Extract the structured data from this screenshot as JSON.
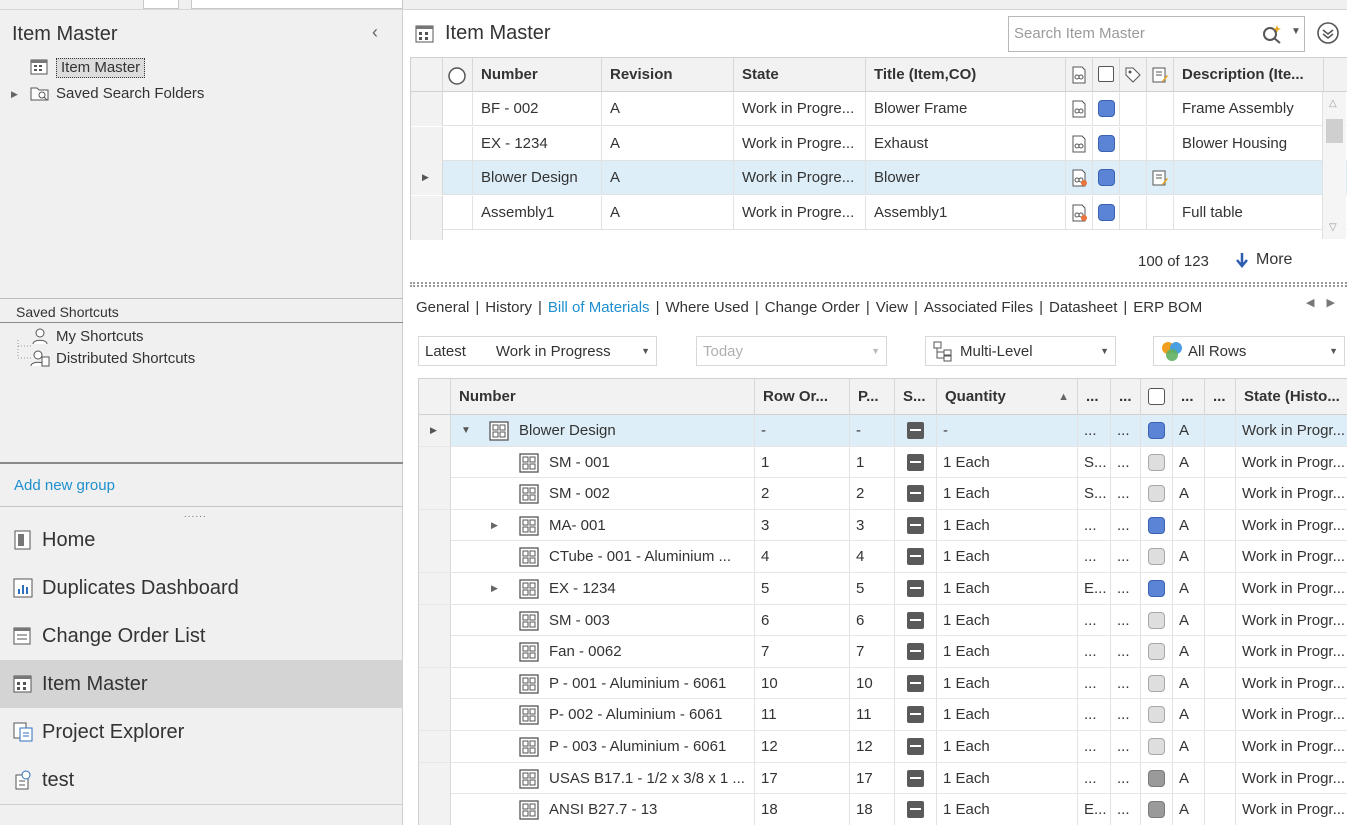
{
  "left": {
    "title": "Item Master",
    "tree": [
      {
        "label": "Item Master",
        "icon": "item-master-icon"
      },
      {
        "label": "Saved Search Folders",
        "icon": "saved-search-folder-icon"
      }
    ],
    "shortcuts_header": "Saved Shortcuts",
    "shortcuts": [
      {
        "label": "My Shortcuts",
        "icon": "user-icon"
      },
      {
        "label": "Distributed Shortcuts",
        "icon": "distributed-user-icon"
      }
    ],
    "add_group": "Add new group",
    "grip": "......",
    "nav": [
      {
        "label": "Home",
        "icon": "home-icon",
        "active": false
      },
      {
        "label": "Duplicates Dashboard",
        "icon": "dashboard-icon",
        "active": false
      },
      {
        "label": "Change Order List",
        "icon": "change-order-list-icon",
        "active": false
      },
      {
        "label": "Item Master",
        "icon": "item-master-icon",
        "active": true
      },
      {
        "label": "Project Explorer",
        "icon": "project-explorer-icon",
        "active": false
      },
      {
        "label": "test",
        "icon": "test-icon",
        "active": false
      }
    ]
  },
  "main": {
    "title": "Item Master",
    "search_placeholder": "Search Item Master",
    "top_grid": {
      "headers": {
        "number": "Number",
        "revision": "Revision",
        "state": "State",
        "title": "Title (Item,CO)",
        "description": "Description (Ite..."
      },
      "rows": [
        {
          "number": "BF - 002",
          "revision": "A",
          "state": "Work in Progre...",
          "title": "Blower Frame",
          "description": "Frame Assembly",
          "has_note": false,
          "selected": false
        },
        {
          "number": "EX - 1234",
          "revision": "A",
          "state": "Work in Progre...",
          "title": "Exhaust",
          "description": "Blower Housing",
          "has_note": false,
          "selected": false
        },
        {
          "number": "Blower Design",
          "revision": "A",
          "state": "Work in Progre...",
          "title": "Blower",
          "description": "",
          "has_note": true,
          "selected": true
        },
        {
          "number": "Assembly1",
          "revision": "A",
          "state": "Work in Progre...",
          "title": "Assembly1",
          "description": "Full table",
          "has_note": false,
          "selected": false
        }
      ]
    },
    "count_text": "100 of 123",
    "more_label": "More",
    "tabs": [
      "General",
      "History",
      "Bill of Materials",
      "Where Used",
      "Change Order",
      "View",
      "Associated Files",
      "Datasheet",
      "ERP BOM"
    ],
    "active_tab": "Bill of Materials",
    "filters": {
      "latest_label": "Latest",
      "latest_value": "Work in Progress",
      "date_value": "Today",
      "level_value": "Multi-Level",
      "rows_value": "All Rows"
    },
    "bom_grid": {
      "headers": {
        "number": "Number",
        "row_order": "Row Or...",
        "p": "P...",
        "s": "S...",
        "quantity": "Quantity",
        "e1": "...",
        "e2": "...",
        "e3": "...",
        "e4": "...",
        "state": "State (Histo..."
      },
      "rows": [
        {
          "number": "Blower Design",
          "row_order": "-",
          "p": "-",
          "quantity": "-",
          "c1": "...",
          "c2": "...",
          "status": "blue",
          "rev": "A",
          "state": "Work in Progr...",
          "level": 0,
          "expander": "open",
          "selected": true
        },
        {
          "number": "SM - 001",
          "row_order": "1",
          "p": "1",
          "quantity": "1 Each",
          "c1": "S...",
          "c2": "...",
          "status": "gray",
          "rev": "A",
          "state": "Work in Progr...",
          "level": 1,
          "expander": "none",
          "selected": false
        },
        {
          "number": "SM - 002",
          "row_order": "2",
          "p": "2",
          "quantity": "1 Each",
          "c1": "S...",
          "c2": "...",
          "status": "gray",
          "rev": "A",
          "state": "Work in Progr...",
          "level": 1,
          "expander": "none",
          "selected": false
        },
        {
          "number": "MA- 001",
          "row_order": "3",
          "p": "3",
          "quantity": "1 Each",
          "c1": "...",
          "c2": "...",
          "status": "blue",
          "rev": "A",
          "state": "Work in Progr...",
          "level": 1,
          "expander": "closed",
          "selected": false
        },
        {
          "number": "CTube - 001 - Aluminium ...",
          "row_order": "4",
          "p": "4",
          "quantity": "1 Each",
          "c1": "...",
          "c2": "...",
          "status": "gray",
          "rev": "A",
          "state": "Work in Progr...",
          "level": 1,
          "expander": "none",
          "selected": false
        },
        {
          "number": "EX - 1234",
          "row_order": "5",
          "p": "5",
          "quantity": "1 Each",
          "c1": "E...",
          "c2": "...",
          "status": "blue",
          "rev": "A",
          "state": "Work in Progr...",
          "level": 1,
          "expander": "closed",
          "selected": false
        },
        {
          "number": "SM - 003",
          "row_order": "6",
          "p": "6",
          "quantity": "1 Each",
          "c1": "...",
          "c2": "...",
          "status": "gray",
          "rev": "A",
          "state": "Work in Progr...",
          "level": 1,
          "expander": "none",
          "selected": false
        },
        {
          "number": "Fan - 0062",
          "row_order": "7",
          "p": "7",
          "quantity": "1 Each",
          "c1": "...",
          "c2": "...",
          "status": "gray",
          "rev": "A",
          "state": "Work in Progr...",
          "level": 1,
          "expander": "none",
          "selected": false
        },
        {
          "number": "P - 001 - Aluminium - 6061",
          "row_order": "10",
          "p": "10",
          "quantity": "1 Each",
          "c1": "...",
          "c2": "...",
          "status": "gray",
          "rev": "A",
          "state": "Work in Progr...",
          "level": 1,
          "expander": "none",
          "selected": false
        },
        {
          "number": "P- 002 - Aluminium - 6061",
          "row_order": "11",
          "p": "11",
          "quantity": "1 Each",
          "c1": "...",
          "c2": "...",
          "status": "gray",
          "rev": "A",
          "state": "Work in Progr...",
          "level": 1,
          "expander": "none",
          "selected": false
        },
        {
          "number": "P - 003 - Aluminium - 6061",
          "row_order": "12",
          "p": "12",
          "quantity": "1 Each",
          "c1": "...",
          "c2": "...",
          "status": "gray",
          "rev": "A",
          "state": "Work in Progr...",
          "level": 1,
          "expander": "none",
          "selected": false
        },
        {
          "number": "USAS B17.1 - 1/2 x 3/8 x 1 ...",
          "row_order": "17",
          "p": "17",
          "quantity": "1 Each",
          "c1": "...",
          "c2": "...",
          "status": "dgray",
          "rev": "A",
          "state": "Work in Progr...",
          "level": 1,
          "expander": "none",
          "selected": false
        },
        {
          "number": "ANSI B27.7 - 13",
          "row_order": "18",
          "p": "18",
          "quantity": "1 Each",
          "c1": "E...",
          "c2": "...",
          "status": "dgray",
          "rev": "A",
          "state": "Work in Progr...",
          "level": 1,
          "expander": "none",
          "selected": false
        }
      ]
    }
  },
  "colors": {
    "accent": "#1e8fcf",
    "selection": "#ddeef8",
    "status_blue": "#5b84d6"
  }
}
